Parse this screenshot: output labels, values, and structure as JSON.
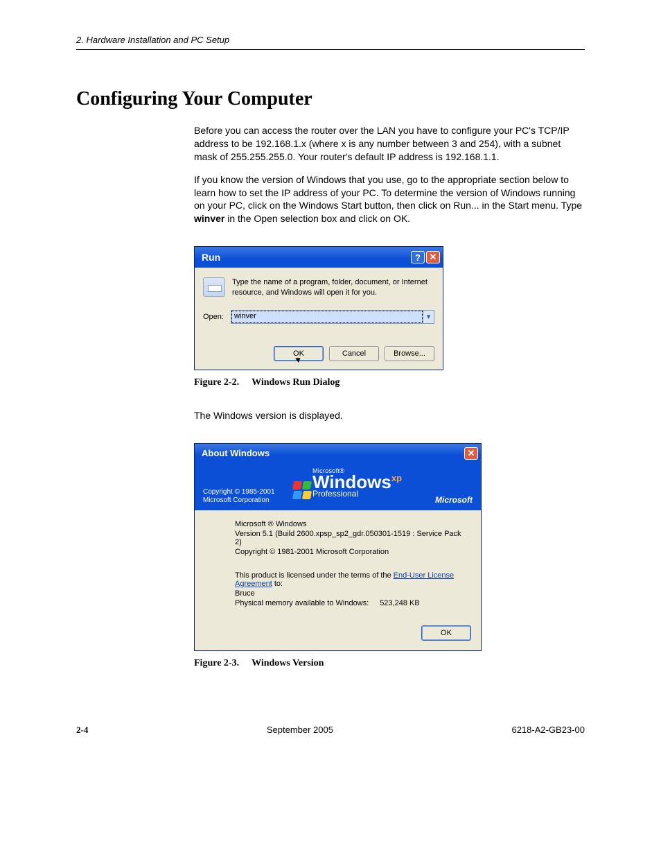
{
  "header": {
    "chapter": "2. Hardware Installation and PC Setup"
  },
  "section": {
    "title": "Configuring Your Computer"
  },
  "para1": "Before you can access the router over the LAN you have to configure your PC's TCP/IP address to be 192.168.1.x (where x is any number between 3 and 254), with a subnet mask of 255.255.255.0. Your router's default IP address is 192.168.1.1.",
  "para2a": "If you know the version of Windows that you use, go to the appropriate section below to learn how to set the IP address of your PC. To determine the version of Windows running on your PC, click on the Windows Start button, then click on Run... in the Start menu. Type ",
  "para2b": "winver",
  "para2c": " in the Open selection box and click on OK.",
  "run": {
    "title": "Run",
    "help": "?",
    "close": "✕",
    "desc": "Type the name of a program, folder, document, or Internet resource, and Windows will open it for you.",
    "open_label": "Open:",
    "value": "winver",
    "ok": "OK",
    "cancel": "Cancel",
    "browse": "Browse..."
  },
  "fig1": {
    "num": "Figure 2-2.",
    "caption": "Windows Run Dialog"
  },
  "para3": "The Windows version is displayed.",
  "about": {
    "title": "About Windows",
    "close": "✕",
    "copy1": "Copyright © 1985-2001",
    "copy2": "Microsoft Corporation",
    "ms": "Microsoft®",
    "win": "Windows",
    "xp": "xp",
    "pro": "Professional",
    "brand": "Microsoft",
    "line1": "Microsoft ® Windows",
    "line2": "Version 5.1 (Build 2600.xpsp_sp2_gdr.050301-1519 : Service Pack 2)",
    "line3": "Copyright © 1981-2001 Microsoft Corporation",
    "lic1": "This product is licensed under the terms of the ",
    "lic_link": "End-User License Agreement",
    "lic2": " to:",
    "user": "Bruce",
    "mem_label": "Physical memory available to Windows:",
    "mem_value": "523,248 KB",
    "ok": "OK"
  },
  "fig2": {
    "num": "Figure 2-3.",
    "caption": "Windows Version"
  },
  "footer": {
    "page": "2-4",
    "date": "September 2005",
    "doc": "6218-A2-GB23-00"
  }
}
